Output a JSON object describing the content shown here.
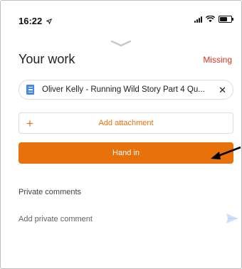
{
  "status_bar": {
    "time": "16:22",
    "location_arrow": "location-arrow-icon",
    "icons": [
      "signal-icon",
      "wifi-icon",
      "battery-icon"
    ]
  },
  "header": {
    "title": "Your work",
    "status": "Missing"
  },
  "attachment": {
    "icon": "google-docs-icon",
    "name": "Oliver Kelly - Running Wild Story Part 4 Qu...",
    "remove_icon": "close-icon"
  },
  "actions": {
    "add_attachment_icon": "plus-icon",
    "add_attachment": "Add attachment",
    "hand_in": "Hand in"
  },
  "comments": {
    "section_label": "Private comments",
    "placeholder": "Add private comment",
    "send_icon": "send-icon"
  },
  "colors": {
    "accent": "#e8710a",
    "missing": "#d93025",
    "doc_blue": "#4285f4"
  }
}
